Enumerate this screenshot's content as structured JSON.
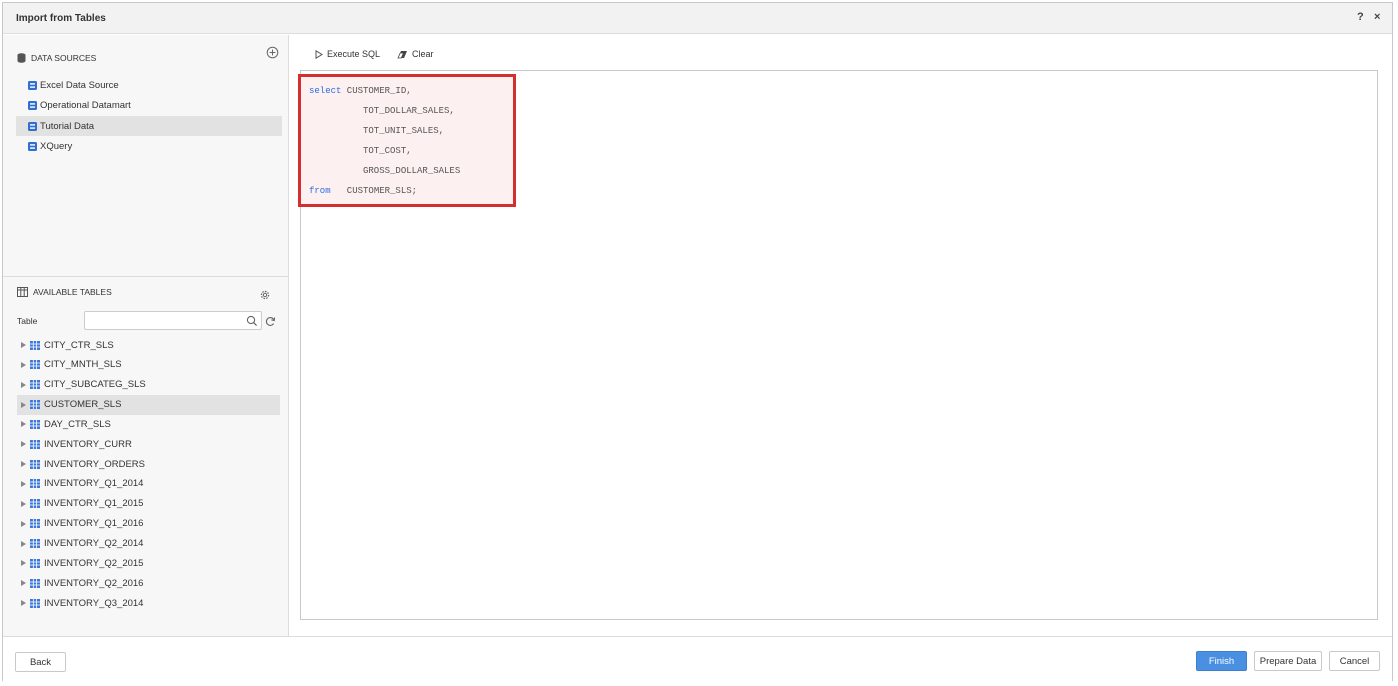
{
  "window": {
    "title": "Import from Tables",
    "help": "?",
    "close": "×"
  },
  "data_sources": {
    "heading": "DATA SOURCES",
    "items": [
      {
        "label": "Excel Data Source",
        "selected": false
      },
      {
        "label": "Operational Datamart",
        "selected": false
      },
      {
        "label": "Tutorial Data",
        "selected": true
      },
      {
        "label": "XQuery",
        "selected": false
      }
    ]
  },
  "available_tables": {
    "heading": "AVAILABLE TABLES",
    "filter_label": "Table",
    "search_value": "",
    "tables": [
      {
        "label": "CITY_CTR_SLS",
        "selected": false
      },
      {
        "label": "CITY_MNTH_SLS",
        "selected": false
      },
      {
        "label": "CITY_SUBCATEG_SLS",
        "selected": false
      },
      {
        "label": "CUSTOMER_SLS",
        "selected": true
      },
      {
        "label": "DAY_CTR_SLS",
        "selected": false
      },
      {
        "label": "INVENTORY_CURR",
        "selected": false
      },
      {
        "label": "INVENTORY_ORDERS",
        "selected": false
      },
      {
        "label": "INVENTORY_Q1_2014",
        "selected": false
      },
      {
        "label": "INVENTORY_Q1_2015",
        "selected": false
      },
      {
        "label": "INVENTORY_Q1_2016",
        "selected": false
      },
      {
        "label": "INVENTORY_Q2_2014",
        "selected": false
      },
      {
        "label": "INVENTORY_Q2_2015",
        "selected": false
      },
      {
        "label": "INVENTORY_Q2_2016",
        "selected": false
      },
      {
        "label": "INVENTORY_Q3_2014",
        "selected": false
      }
    ]
  },
  "toolbar": {
    "execute_label": "Execute SQL",
    "clear_label": "Clear"
  },
  "editor": {
    "lines": [
      {
        "kw": "select",
        "text": " CUSTOMER_ID,"
      },
      {
        "kw": "",
        "text": "          TOT_DOLLAR_SALES,"
      },
      {
        "kw": "",
        "text": "          TOT_UNIT_SALES,"
      },
      {
        "kw": "",
        "text": "          TOT_COST,"
      },
      {
        "kw": "",
        "text": "          GROSS_DOLLAR_SALES"
      },
      {
        "kw": "from",
        "text": "   CUSTOMER_SLS;"
      }
    ]
  },
  "footer": {
    "back": "Back",
    "finish": "Finish",
    "prepare": "Prepare Data",
    "cancel": "Cancel"
  },
  "colors": {
    "accent": "#4a90e2",
    "highlight_border": "#d32f2f",
    "keyword": "#2b6de0"
  }
}
